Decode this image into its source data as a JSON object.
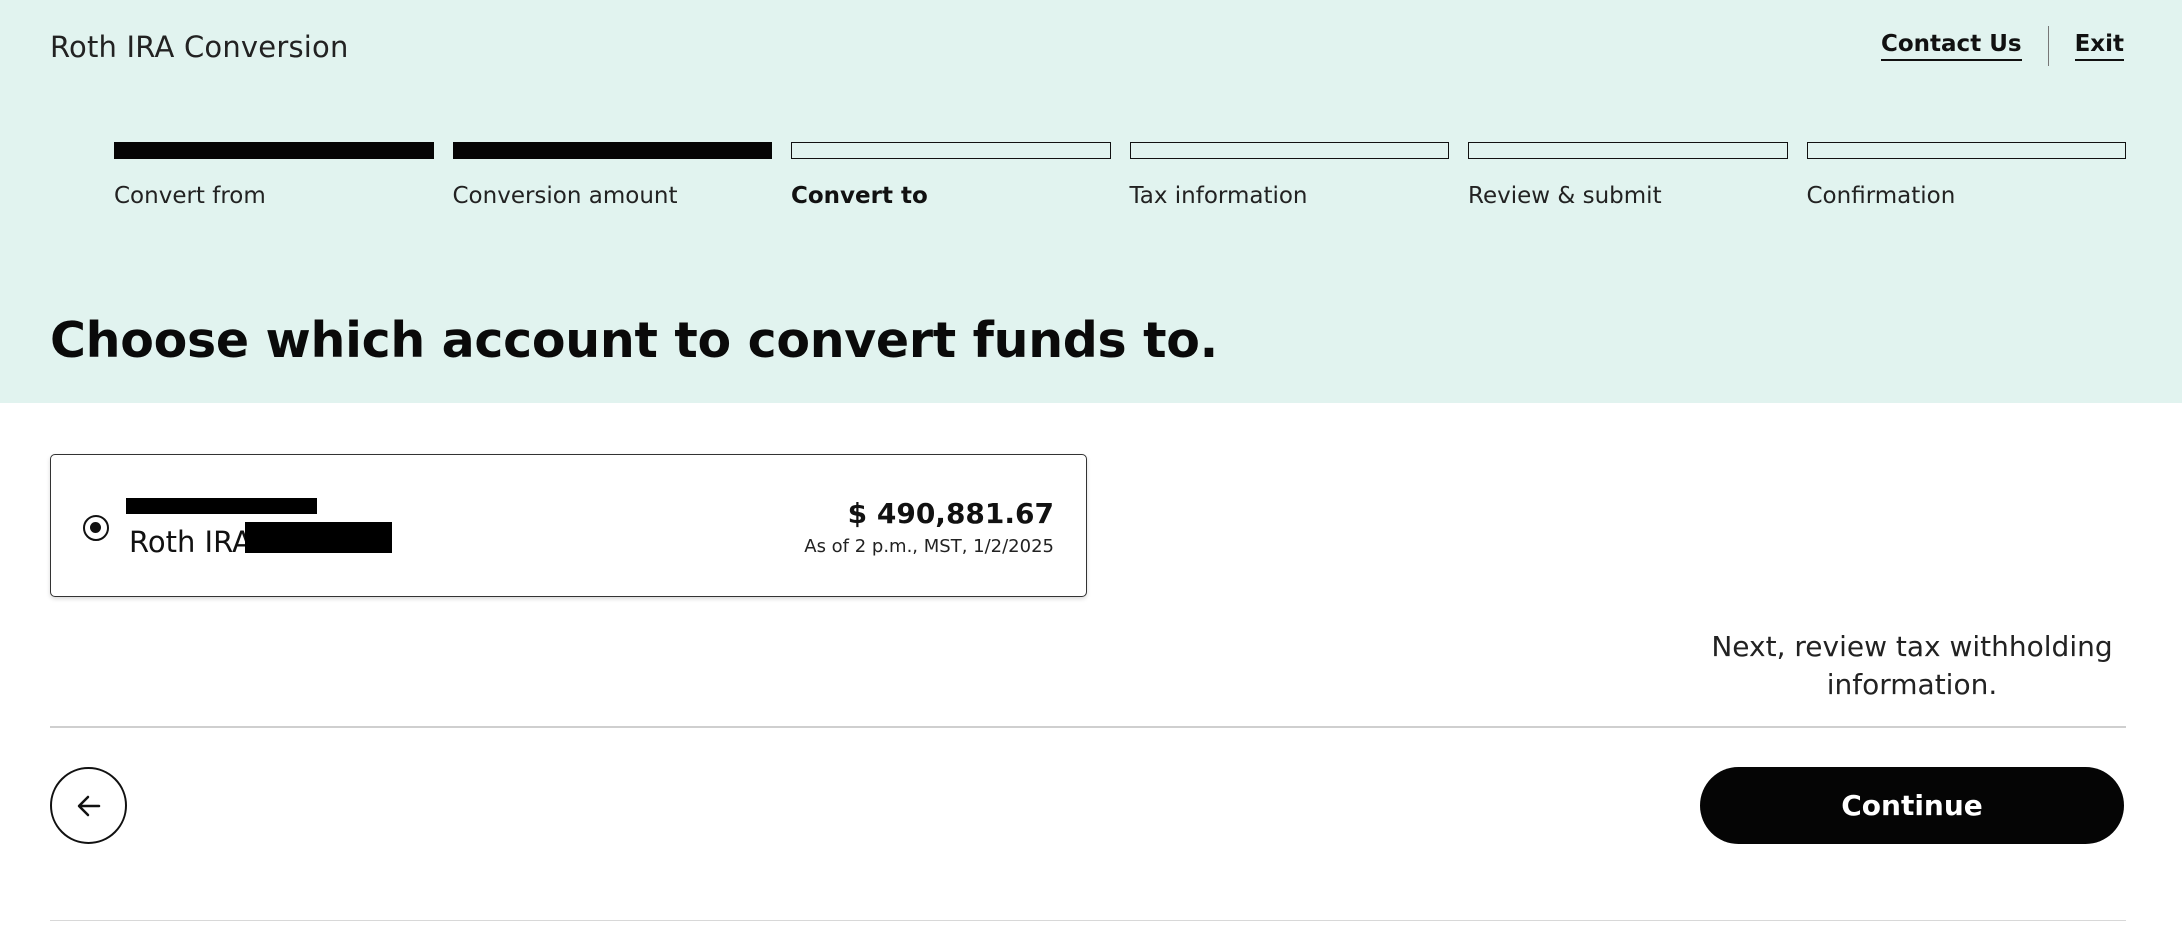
{
  "header": {
    "title": "Roth IRA Conversion",
    "links": {
      "contact": "Contact Us",
      "exit": "Exit"
    }
  },
  "stepper": {
    "steps": [
      {
        "label": "Convert from",
        "state": "done"
      },
      {
        "label": "Conversion amount",
        "state": "done"
      },
      {
        "label": "Convert to",
        "state": "current"
      },
      {
        "label": "Tax information",
        "state": "upcoming"
      },
      {
        "label": "Review & submit",
        "state": "upcoming"
      },
      {
        "label": "Confirmation",
        "state": "upcoming"
      }
    ]
  },
  "main": {
    "heading": "Choose which account to convert funds to.",
    "account": {
      "type": "Roth IRA",
      "selected": true,
      "balance": "$ 490,881.67",
      "as_of": "As of 2 p.m., MST, 1/2/2025"
    },
    "next_hint": "Next, review tax withholding information."
  },
  "footer": {
    "back_icon": "arrow-left-icon",
    "continue_label": "Continue"
  },
  "colors": {
    "header_bg": "#e1f3ef",
    "primary": "#050505"
  }
}
